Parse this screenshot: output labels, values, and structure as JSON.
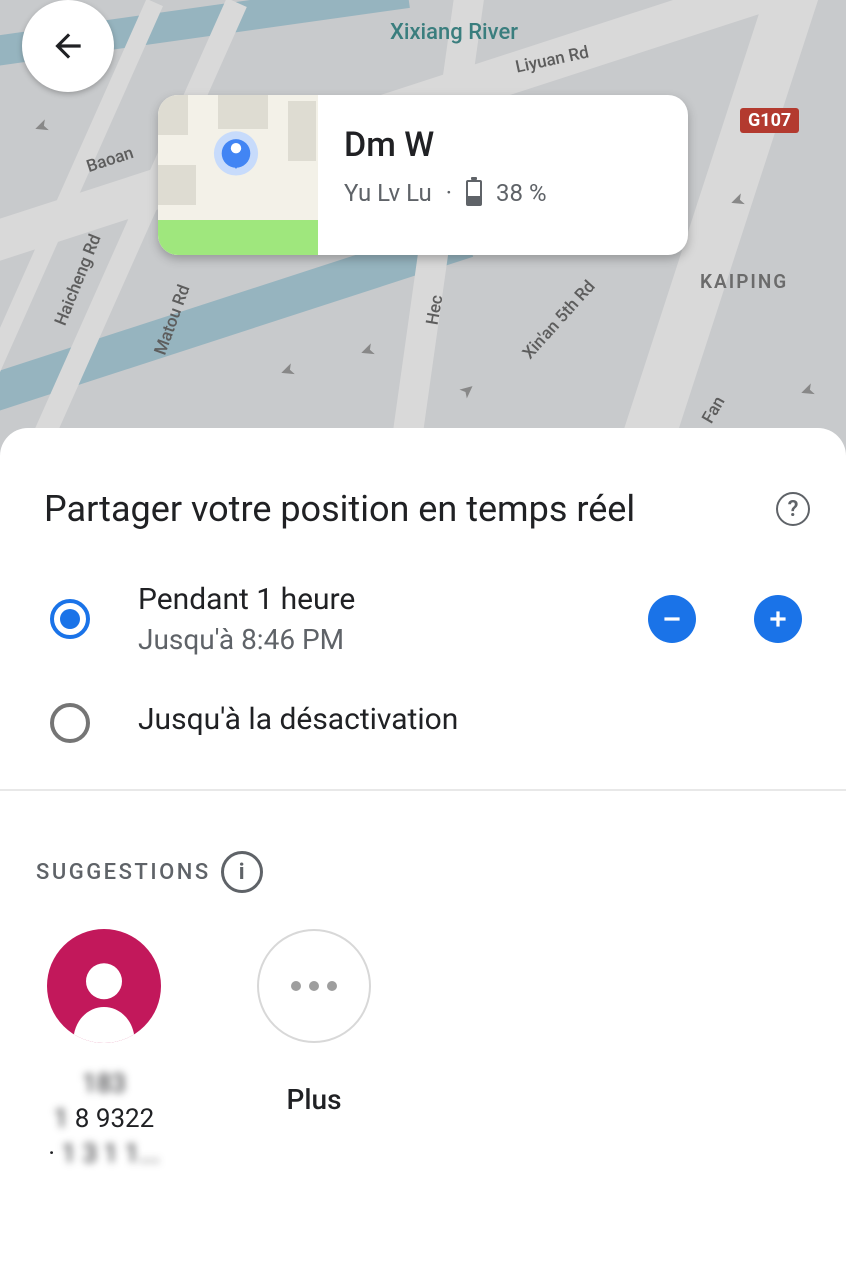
{
  "map": {
    "river_label": "Xixiang River",
    "district_label": "KAIPING",
    "highway_shield": "G107",
    "roads": {
      "liyuan": "Liyuan Rd",
      "baoan": "Baoan",
      "haicheng": "Haicheng Rd",
      "matou": "Matou Rd",
      "hec": "Hec",
      "xinan5": "Xin'an 5th Rd",
      "fan": "Fan"
    }
  },
  "card": {
    "name": "Dm W",
    "location": "Yu Lv Lu",
    "battery_pct": "38 %"
  },
  "sheet": {
    "title": "Partager votre position en temps réel",
    "option1_title": "Pendant 1 heure",
    "option1_sub": "Jusqu'à 8:46 PM",
    "option2_title": "Jusqu'à la désactivation",
    "suggestions_label": "SUGGESTIONS",
    "contact_line1": "183",
    "contact_line2": "8 9322",
    "contact_line3": "1 3 1 1...",
    "more_label": "Plus"
  }
}
